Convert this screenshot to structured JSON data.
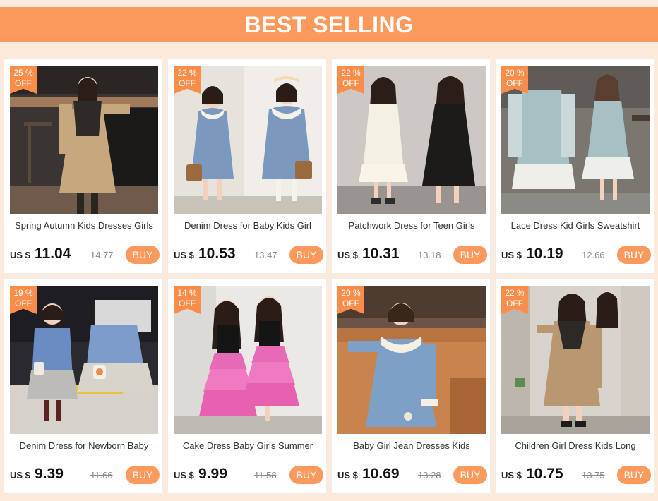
{
  "banner": {
    "title": "BEST SELLING",
    "color": "#fb9a5c"
  },
  "currency_label": "US $",
  "buy_label": "BUY",
  "products": [
    {
      "discount": "25 %",
      "off": "OFF",
      "title": "Spring Autumn Kids Dresses Girls",
      "price": "11.04",
      "old_price": "14.77",
      "scene": "bar-girl-khaki"
    },
    {
      "discount": "22 %",
      "off": "OFF",
      "title": "Denim Dress for Baby Kids Girl",
      "price": "10.53",
      "old_price": "13.47",
      "scene": "denim-two-girls"
    },
    {
      "discount": "22 %",
      "off": "OFF",
      "title": "Patchwork Dress for Teen Girls",
      "price": "10.31",
      "old_price": "13.18",
      "scene": "patchwork-two"
    },
    {
      "discount": "20 %",
      "off": "OFF",
      "title": "Lace Dress Kid Girls Sweatshirt",
      "price": "10.19",
      "old_price": "12.66",
      "scene": "sweatshirt-blue"
    },
    {
      "discount": "19 %",
      "off": "OFF",
      "title": "Denim Dress for Newborn Baby",
      "price": "9.39",
      "old_price": "11.66",
      "scene": "newborn-denim"
    },
    {
      "discount": "14 %",
      "off": "OFF",
      "title": "Cake Dress Baby Girls Summer",
      "price": "9.99",
      "old_price": "11.58",
      "scene": "cake-pink"
    },
    {
      "discount": "20 %",
      "off": "OFF",
      "title": "Baby Girl Jean Dresses Kids",
      "price": "10.69",
      "old_price": "13.28",
      "scene": "jean-sofa"
    },
    {
      "discount": "22 %",
      "off": "OFF",
      "title": "Children Girl Dress Kids Long",
      "price": "10.75",
      "old_price": "13.75",
      "scene": "long-khaki"
    }
  ]
}
